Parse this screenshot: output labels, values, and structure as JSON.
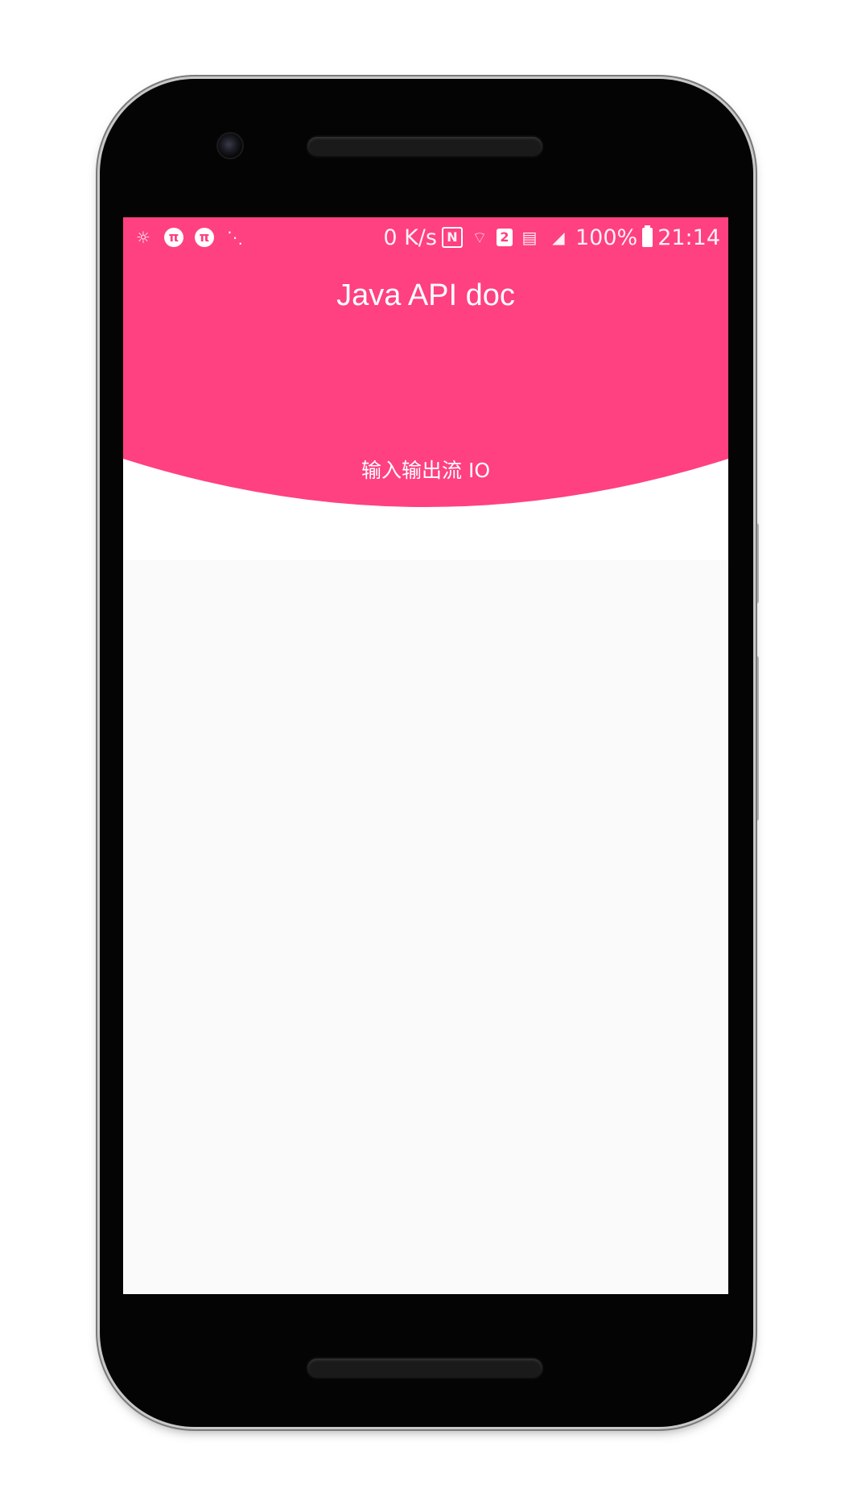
{
  "app": {
    "title": "Java API doc",
    "subtitle": "输入输出流 IO",
    "accent_color": "#ff4081",
    "background_color": "#fafafa"
  },
  "status_bar": {
    "left_icons": [
      "brightness-icon",
      "pi-icon",
      "pi-icon",
      "share-icon"
    ],
    "network_speed": "0 K/s",
    "nfc_label": "N",
    "sim_badge": "2",
    "battery_percent": "100%",
    "time": "21:14"
  },
  "icons": {
    "brightness": "☼",
    "pi": "π",
    "share": "⋱",
    "wifi": "⌔",
    "sim_card": "▤",
    "signal": "◢"
  }
}
